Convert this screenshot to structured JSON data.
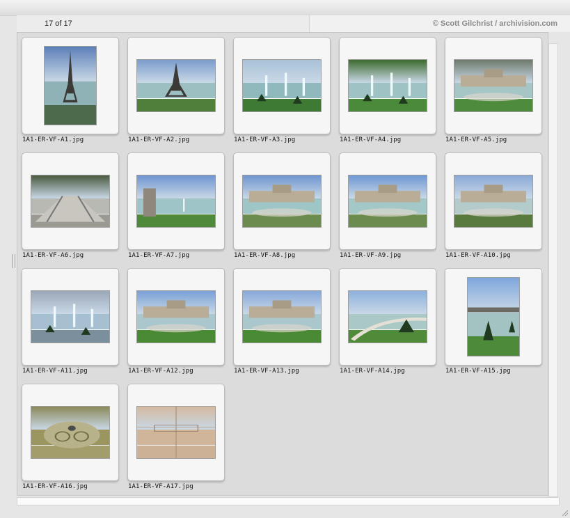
{
  "header": {
    "count_label": "17 of 17",
    "credit": "© Scott Gilchrist / archivision.com"
  },
  "thumbnails": [
    {
      "filename": "1A1-ER-VF-A1.jpg",
      "orientation": "portrait",
      "scene": "tower",
      "sky": "#5d7fb8",
      "ground": "#4e6a4c",
      "water": "#8fb2b6"
    },
    {
      "filename": "1A1-ER-VF-A2.jpg",
      "orientation": "landscape",
      "scene": "tower",
      "sky": "#7b9ccc",
      "ground": "#4f7f3a",
      "water": "#9cc0c2"
    },
    {
      "filename": "1A1-ER-VF-A3.jpg",
      "orientation": "landscape",
      "scene": "basin",
      "sky": "#a9c2d8",
      "ground": "#3f7a35",
      "water": "#8fb9bd"
    },
    {
      "filename": "1A1-ER-VF-A4.jpg",
      "orientation": "landscape",
      "scene": "fountain",
      "sky": "#3d6b2f",
      "ground": "#4c8a3b",
      "water": "#9fc2c4"
    },
    {
      "filename": "1A1-ER-VF-A5.jpg",
      "orientation": "landscape",
      "scene": "terrace",
      "sky": "#6f7a6c",
      "ground": "#4e8b3c",
      "water": "#a6c6c6"
    },
    {
      "filename": "1A1-ER-VF-A6.jpg",
      "orientation": "landscape",
      "scene": "steps",
      "sky": "#4a5a40",
      "ground": "#9a9a92",
      "water": "#b9b9b3"
    },
    {
      "filename": "1A1-ER-VF-A7.jpg",
      "orientation": "landscape",
      "scene": "statue",
      "sky": "#6e95d0",
      "ground": "#4f8a3a",
      "water": "#9ec4c8"
    },
    {
      "filename": "1A1-ER-VF-A8.jpg",
      "orientation": "landscape",
      "scene": "palais",
      "sky": "#6e95cf",
      "ground": "#6c8b4f",
      "water": "#9fc6c6"
    },
    {
      "filename": "1A1-ER-VF-A9.jpg",
      "orientation": "landscape",
      "scene": "palais",
      "sky": "#6f98d3",
      "ground": "#6c8b4f",
      "water": "#a4c8c8"
    },
    {
      "filename": "1A1-ER-VF-A10.jpg",
      "orientation": "landscape",
      "scene": "palais",
      "sky": "#8aa9d6",
      "ground": "#597a3f",
      "water": "#b3cccb"
    },
    {
      "filename": "1A1-ER-VF-A11.jpg",
      "orientation": "landscape",
      "scene": "jets",
      "sky": "#9aa8b8",
      "ground": "#7c8f9c",
      "water": "#a6bfd1"
    },
    {
      "filename": "1A1-ER-VF-A12.jpg",
      "orientation": "landscape",
      "scene": "wide",
      "sky": "#7aa0d6",
      "ground": "#4b8a35",
      "water": "#a9c7cc"
    },
    {
      "filename": "1A1-ER-VF-A13.jpg",
      "orientation": "landscape",
      "scene": "wide",
      "sky": "#87a9da",
      "ground": "#4b8a35",
      "water": "#a9c7cc"
    },
    {
      "filename": "1A1-ER-VF-A14.jpg",
      "orientation": "landscape",
      "scene": "curve",
      "sky": "#8db0dd",
      "ground": "#4f8b38",
      "water": "#aac8c6"
    },
    {
      "filename": "1A1-ER-VF-A15.jpg",
      "orientation": "portrait",
      "scene": "cone",
      "sky": "#7fa6dc",
      "ground": "#4d8a39",
      "water": "#a3c3c2"
    },
    {
      "filename": "1A1-ER-VF-A16.jpg",
      "orientation": "landscape",
      "scene": "drain",
      "sky": "#8b8a5a",
      "ground": "#a29d6a",
      "water": "#9b9660"
    },
    {
      "filename": "1A1-ER-VF-A17.jpg",
      "orientation": "landscape",
      "scene": "stone",
      "sky": "#d3b9a0",
      "ground": "#cdb196",
      "water": "#d0b59b"
    }
  ]
}
